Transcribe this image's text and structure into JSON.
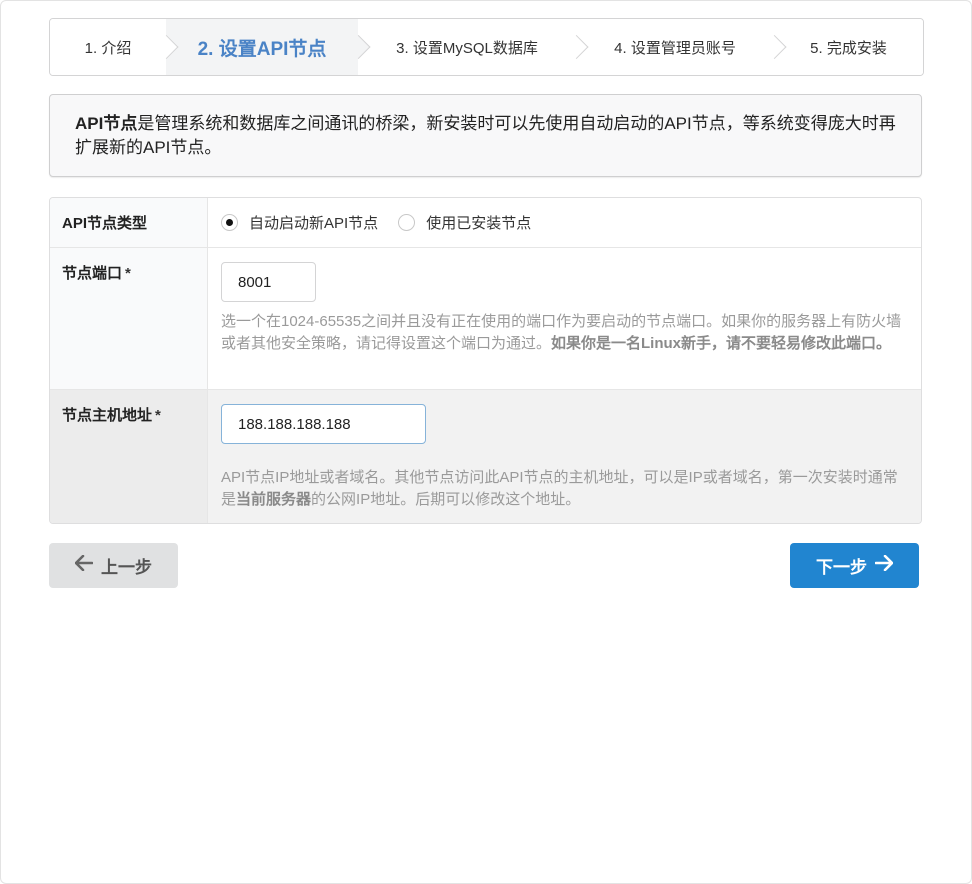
{
  "steps": [
    {
      "label": "1. 介绍"
    },
    {
      "label": "2. 设置API节点",
      "active": true
    },
    {
      "label": "3. 设置MySQL数据库"
    },
    {
      "label": "4. 设置管理员账号"
    },
    {
      "label": "5. 完成安装"
    }
  ],
  "info": {
    "bold": "API节点",
    "text": "是管理系统和数据库之间通讯的桥梁，新安装时可以先使用自动启动的API节点，等系统变得庞大时再扩展新的API节点。"
  },
  "form": {
    "node_type": {
      "label": "API节点类型",
      "options": [
        "自动启动新API节点",
        "使用已安装节点"
      ],
      "selected": "自动启动新API节点"
    },
    "port": {
      "label": "节点端口",
      "required_mark": "*",
      "value": "8001",
      "help": "选一个在1024-65535之间并且没有正在使用的端口作为要启动的节点端口。如果你的服务器上有防火墙或者其他安全策略，请记得设置这个端口为通过。",
      "help_bold": "如果你是一名Linux新手，请不要轻易修改此端口。"
    },
    "host": {
      "label": "节点主机地址",
      "required_mark": "*",
      "value": "188.188.188.188",
      "help_pre": "API节点IP地址或者域名。其他节点访问此API节点的主机地址，可以是IP或者域名，第一次安装时通常是",
      "help_bold": "当前服务器",
      "help_post": "的公网IP地址。后期可以修改这个地址。"
    }
  },
  "buttons": {
    "prev_label": "上一步",
    "next_label": "下一步",
    "prev_icon": "arrow-left-icon",
    "next_icon": "arrow-right-icon"
  },
  "colors": {
    "primary": "#2185d0",
    "active_step": "#4a83c6"
  }
}
